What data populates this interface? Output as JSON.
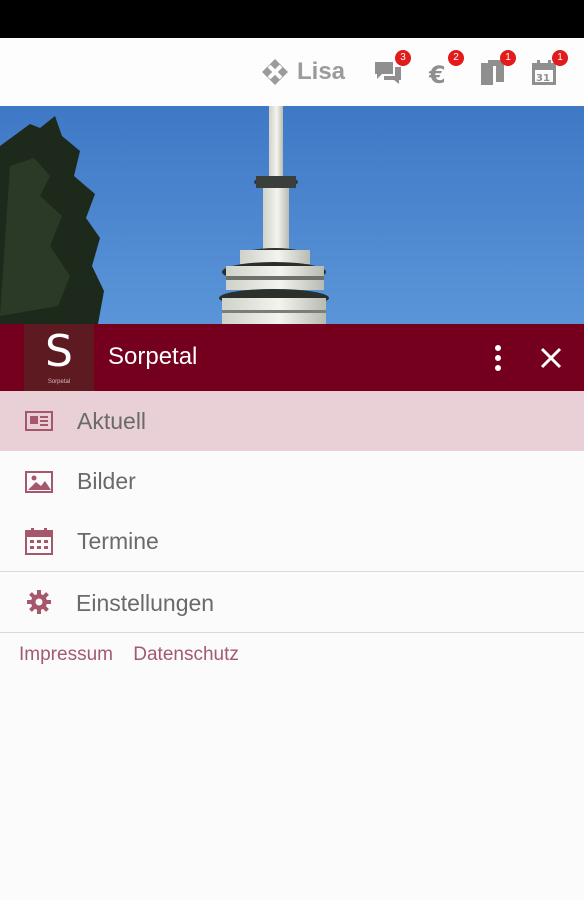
{
  "topbar": {
    "user_label": "Lisa",
    "notifications": [
      {
        "icon": "chat-icon",
        "count": "3"
      },
      {
        "icon": "euro-icon",
        "count": "2"
      },
      {
        "icon": "documents-icon",
        "count": "1"
      },
      {
        "icon": "calendar-icon",
        "count": "1"
      }
    ]
  },
  "brand": {
    "title": "Sorpetal",
    "logo_letter": "S",
    "logo_caption": "Sorpetal"
  },
  "menu": {
    "items": [
      {
        "label": "Aktuell",
        "icon": "newspaper-icon"
      },
      {
        "label": "Bilder",
        "icon": "image-icon"
      },
      {
        "label": "Termine",
        "icon": "calendar-icon"
      }
    ],
    "settings_label": "Einstellungen"
  },
  "footer": {
    "impressum": "Impressum",
    "datenschutz": "Datenschutz"
  },
  "colors": {
    "brand": "#74001d",
    "accent": "#a5576b",
    "active_bg": "#e8d0d6",
    "badge": "#e21b1b"
  }
}
